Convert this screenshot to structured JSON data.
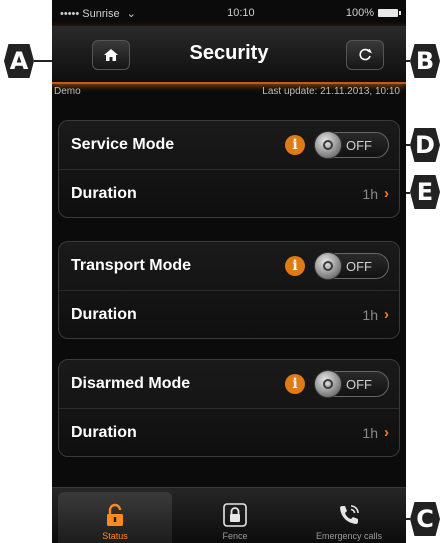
{
  "status_bar": {
    "carrier": "••••• Sunrise",
    "wifi": "⌄",
    "time": "10:10",
    "battery": "100%"
  },
  "nav": {
    "title": "Security",
    "home_icon": "home-icon",
    "refresh_icon": "refresh-icon"
  },
  "subheader": {
    "left": "Demo",
    "right": "Last update: 21.11.2013, 10:10"
  },
  "groups": [
    {
      "mode_label": "Service Mode",
      "toggle": "OFF",
      "duration_label": "Duration",
      "duration_value": "1h"
    },
    {
      "mode_label": "Transport Mode",
      "toggle": "OFF",
      "duration_label": "Duration",
      "duration_value": "1h"
    },
    {
      "mode_label": "Disarmed Mode",
      "toggle": "OFF",
      "duration_label": "Duration",
      "duration_value": "1h"
    }
  ],
  "tabs": [
    {
      "label": "Status",
      "icon": "padlock-open-icon",
      "active": true
    },
    {
      "label": "Fence",
      "icon": "padlock-closed-icon",
      "active": false
    },
    {
      "label": "Emergency calls",
      "icon": "phone-icon",
      "active": false
    }
  ],
  "callouts": {
    "a": "A",
    "b": "B",
    "c": "C",
    "d": "D",
    "e": "E"
  },
  "colors": {
    "accent": "#e07a17",
    "background": "#0b0b0b"
  }
}
